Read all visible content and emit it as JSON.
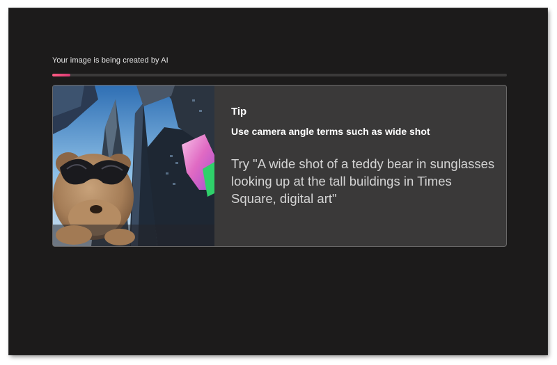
{
  "status": {
    "label": "Your image is being created by AI",
    "progress": 0.04,
    "progress_color": "#e84a7a"
  },
  "tip": {
    "heading": "Tip",
    "subheading": "Use camera angle terms such as wide shot",
    "example": "Try \"A wide shot of a teddy bear in sunglasses looking up at the tall buildings in Times Square, digital art\""
  },
  "colors": {
    "window_bg": "#1c1b1b",
    "card_bg": "#3a3939",
    "track": "#3b3a3a"
  }
}
